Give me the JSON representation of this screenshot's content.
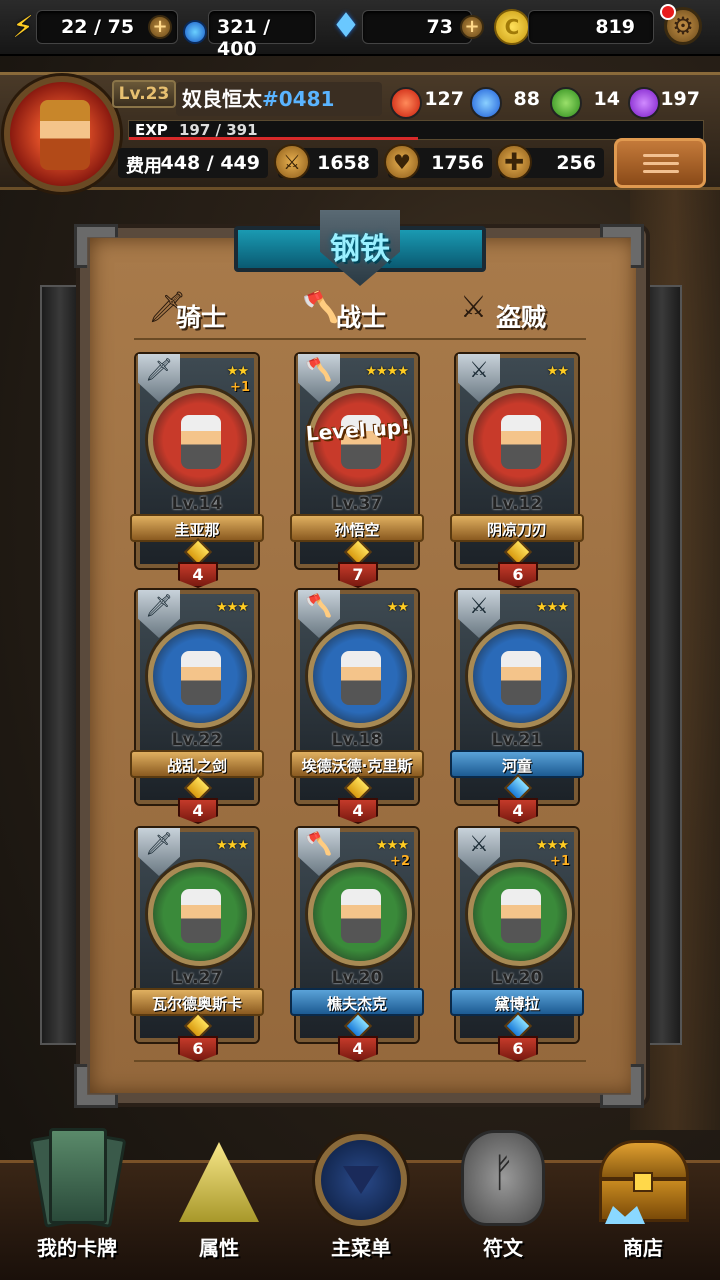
{
  "resources": {
    "energy": "22 / 75",
    "potion": "321 / 400",
    "gems": "73",
    "coins": "819"
  },
  "player": {
    "level": "Lv.23",
    "name": "奴良恒太",
    "tag": "#0481",
    "exp_label": "EXP",
    "exp_value": "197 / 391",
    "exp_fraction": 0.504,
    "cost_label": "费用",
    "cost_value": "448 / 449",
    "attack": "1658",
    "health": "1756",
    "heal": "256",
    "elements": {
      "fire": "127",
      "water": "88",
      "nature": "14",
      "dark": "197"
    }
  },
  "board": {
    "title": "钢铁",
    "columns": [
      "骑士",
      "战士",
      "盗贼"
    ]
  },
  "cards": [
    {
      "level": "Lv.14",
      "name": "圭亚那",
      "stars": "★★",
      "plus": "+1",
      "cost": "4",
      "cls": "knight",
      "banner": "gold",
      "bg": "#c83a2a",
      "note": ""
    },
    {
      "level": "Lv.37",
      "name": "孙悟空",
      "stars": "★★★★",
      "plus": "",
      "cost": "7",
      "cls": "warrior",
      "banner": "gold",
      "bg": "#c83a2a",
      "note": "Level up!"
    },
    {
      "level": "Lv.12",
      "name": "阴凉刀刃",
      "stars": "★★",
      "plus": "",
      "cost": "6",
      "cls": "rogue",
      "banner": "gold",
      "bg": "#c83a2a",
      "note": ""
    },
    {
      "level": "Lv.22",
      "name": "战乱之剑",
      "stars": "★★★",
      "plus": "",
      "cost": "4",
      "cls": "knight",
      "banner": "gold",
      "bg": "#2a6ab8",
      "note": ""
    },
    {
      "level": "Lv.18",
      "name": "埃德沃德·克里斯",
      "stars": "★★",
      "plus": "",
      "cost": "4",
      "cls": "warrior",
      "banner": "gold",
      "bg": "#2a6ab8",
      "note": ""
    },
    {
      "level": "Lv.21",
      "name": "河童",
      "stars": "★★★",
      "plus": "",
      "cost": "4",
      "cls": "rogue",
      "banner": "blue",
      "bg": "#2a6ab8",
      "note": ""
    },
    {
      "level": "Lv.27",
      "name": "瓦尔德奥斯卡",
      "stars": "★★★",
      "plus": "",
      "cost": "6",
      "cls": "knight",
      "banner": "gold",
      "bg": "#3a8a3a",
      "note": ""
    },
    {
      "level": "Lv.20",
      "name": "樵夫杰克",
      "stars": "★★★",
      "plus": "+2",
      "cost": "4",
      "cls": "warrior",
      "banner": "blue",
      "bg": "#3a8a3a",
      "note": ""
    },
    {
      "level": "Lv.20",
      "name": "黛博拉",
      "stars": "★★★",
      "plus": "+1",
      "cost": "6",
      "cls": "rogue",
      "banner": "blue",
      "bg": "#3a8a3a",
      "note": ""
    }
  ],
  "nav": [
    {
      "label": "我的卡牌",
      "icon": "cards-icon"
    },
    {
      "label": "属性",
      "icon": "triforce-icon"
    },
    {
      "label": "主菜单",
      "icon": "emblem-icon"
    },
    {
      "label": "符文",
      "icon": "rune-stone-icon"
    },
    {
      "label": "商店",
      "icon": "treasure-chest-icon"
    }
  ]
}
